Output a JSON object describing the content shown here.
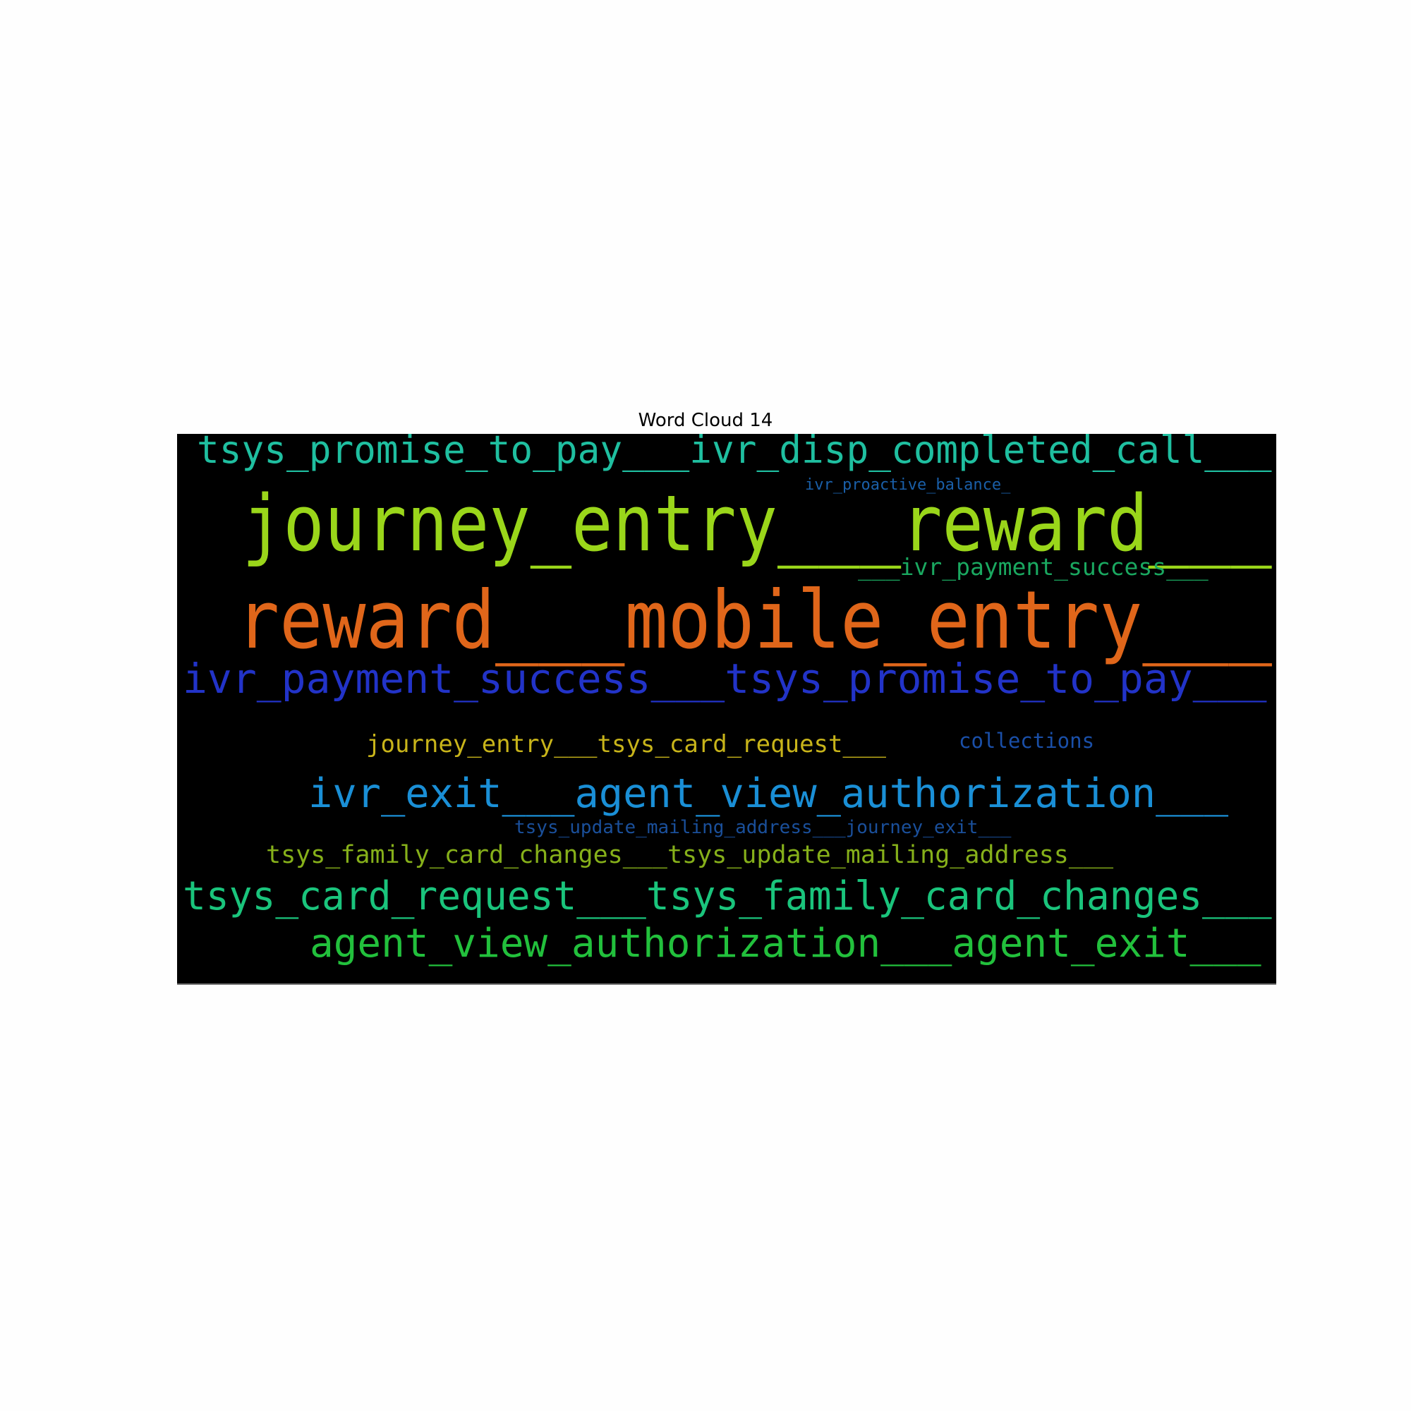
{
  "title": "Word Cloud 14",
  "background_color": "#000000",
  "words": [
    {
      "text": "tsys_promise_to_pay___ivr_disp_completed_call___",
      "color": "#1fbfa0"
    },
    {
      "text": "ivr_proactive_balance_",
      "color": "#1a5fa8"
    },
    {
      "text": "journey_entry___reward___",
      "color": "#9ad61a"
    },
    {
      "text": "___ivr_payment_success___",
      "color": "#1aa860"
    },
    {
      "text": "reward___mobile_entry___",
      "color": "#e0661a"
    },
    {
      "text": "ivr_payment_success___tsys_promise_to_pay___",
      "color": "#2233c8"
    },
    {
      "text": "journey_entry___tsys_card_request___",
      "color": "#c8b41a"
    },
    {
      "text": "collections",
      "color": "#1a4fa8"
    },
    {
      "text": "ivr_exit___agent_view_authorization___",
      "color": "#1a8fd6"
    },
    {
      "text": "tsys_update_mailing_address___journey_exit___",
      "color": "#1a4f9a"
    },
    {
      "text": "tsys_family_card_changes___tsys_update_mailing_address___",
      "color": "#86b01a"
    },
    {
      "text": "tsys_card_request___tsys_family_card_changes___",
      "color": "#1ac47c"
    },
    {
      "text": "agent_view_authorization___agent_exit___",
      "color": "#22c03c"
    }
  ]
}
